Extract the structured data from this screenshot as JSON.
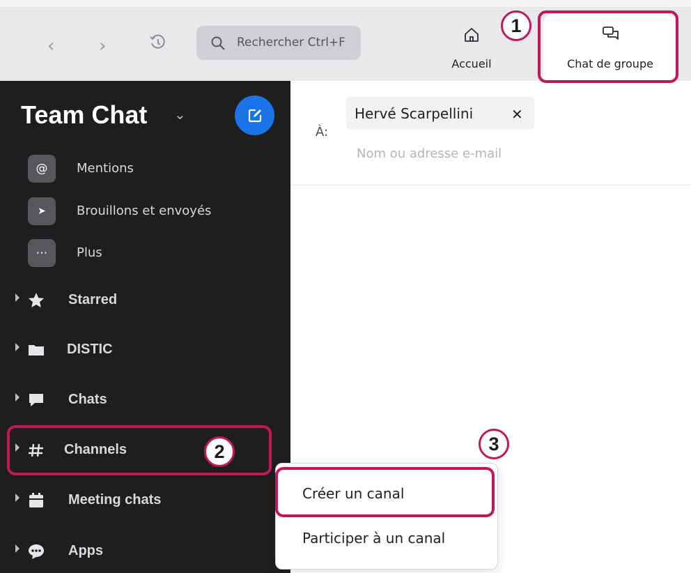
{
  "topbar": {
    "back_symbol": "‹",
    "forward_symbol": "›",
    "search_placeholder": "Rechercher Ctrl+F",
    "tabs": [
      {
        "label": "Accueil",
        "icon": "home-icon"
      },
      {
        "label": "Chat de groupe",
        "icon": "chat-bubbles-icon",
        "active": true
      }
    ]
  },
  "sidebar": {
    "title": "Team Chat",
    "title_chevron": "⌄",
    "nav_items": [
      {
        "label": "Mentions",
        "icon": "at-icon",
        "glyph": "@"
      },
      {
        "label": "Brouillons et envoyés",
        "icon": "send-icon",
        "glyph": "➤"
      },
      {
        "label": "Plus",
        "icon": "more-icon",
        "glyph": "⋯"
      }
    ],
    "sections": [
      {
        "label": "Starred",
        "icon": "star-icon"
      },
      {
        "label": "DISTIC",
        "icon": "folder-icon"
      },
      {
        "label": "Chats",
        "icon": "chat-icon"
      },
      {
        "label": "Channels",
        "icon": "hash-icon"
      },
      {
        "label": "Meeting chats",
        "icon": "calendar-icon"
      },
      {
        "label": "Apps",
        "icon": "apps-icon"
      }
    ]
  },
  "compose": {
    "to_label": "À:",
    "recipient": "Hervé Scarpellini",
    "remove_symbol": "✕",
    "input_placeholder": "Nom ou adresse e-mail"
  },
  "dropdown": {
    "items": [
      {
        "label": "Créer un canal"
      },
      {
        "label": "Participer à un canal"
      }
    ]
  },
  "annotations": {
    "badges": [
      "1",
      "2",
      "3"
    ],
    "highlight_color": "#c2185b"
  },
  "colors": {
    "sidebar_bg": "#1e1e1f",
    "accent_blue": "#1a73e8",
    "topbar_bg": "#e9e9ec"
  }
}
